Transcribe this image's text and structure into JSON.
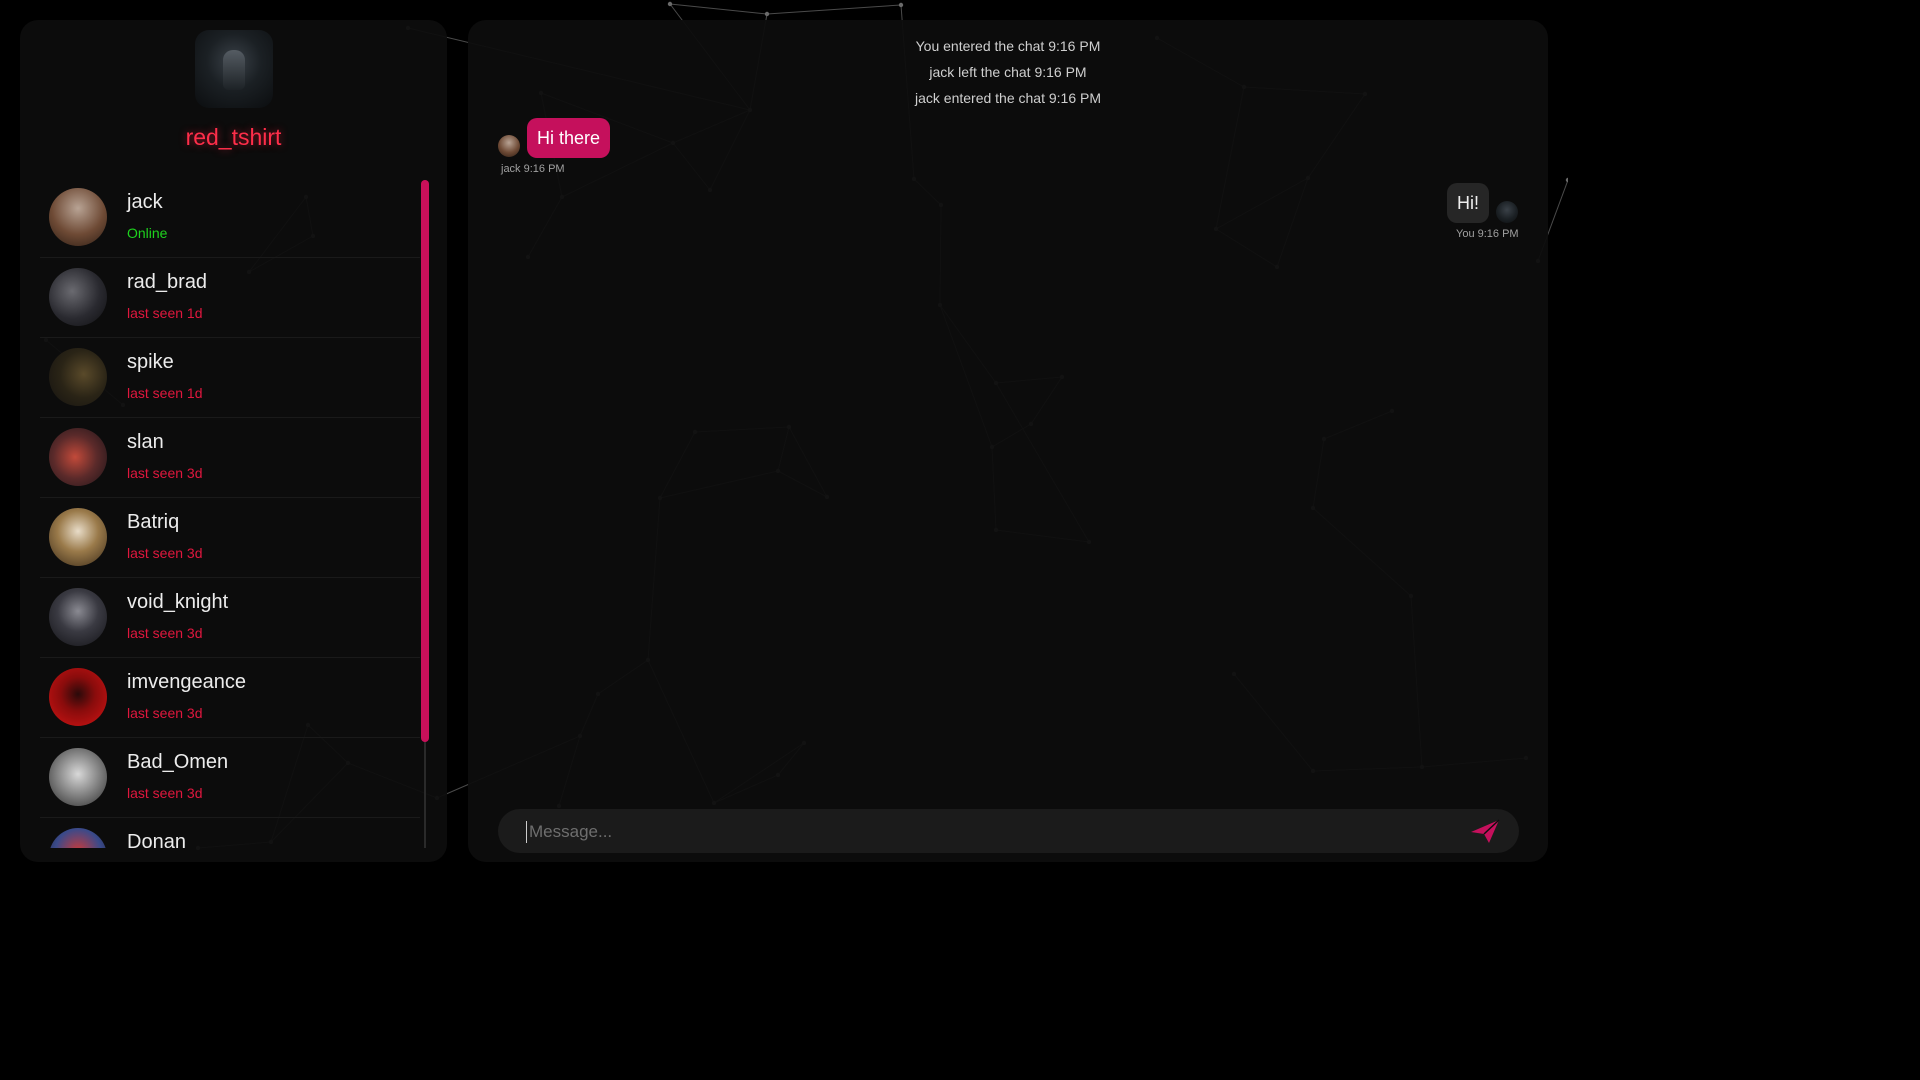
{
  "theme": {
    "accent": "#c5105c",
    "username_color": "#ff2e4a",
    "online_color": "#1ed31e",
    "offline_color": "#e0173e"
  },
  "profile": {
    "username": "red_tshirt",
    "avatar_icon": "profile-avatar-dark-figure"
  },
  "contacts": [
    {
      "name": "jack",
      "status": "Online",
      "online": true
    },
    {
      "name": "rad_brad",
      "status": "last seen 1d",
      "online": false
    },
    {
      "name": "spike",
      "status": "last seen 1d",
      "online": false
    },
    {
      "name": "slan",
      "status": "last seen 3d",
      "online": false
    },
    {
      "name": "Batriq",
      "status": "last seen 3d",
      "online": false
    },
    {
      "name": "void_knight",
      "status": "last seen 3d",
      "online": false
    },
    {
      "name": "imvengeance",
      "status": "last seen 3d",
      "online": false
    },
    {
      "name": "Bad_Omen",
      "status": "last seen 3d",
      "online": false
    },
    {
      "name": "Donan",
      "status": "",
      "online": false
    }
  ],
  "chat": {
    "system_messages": [
      "You entered the chat 9:16 PM",
      "jack left the chat 9:16 PM",
      "jack entered the chat 9:16 PM"
    ],
    "messages": [
      {
        "text": "Hi there",
        "meta": "jack 9:16 PM",
        "direction": "incoming"
      },
      {
        "text": "Hi!",
        "meta": "You 9:16 PM",
        "direction": "outgoing"
      }
    ]
  },
  "composer": {
    "placeholder": "Message...",
    "value": "",
    "send_icon": "paper-plane-icon"
  }
}
